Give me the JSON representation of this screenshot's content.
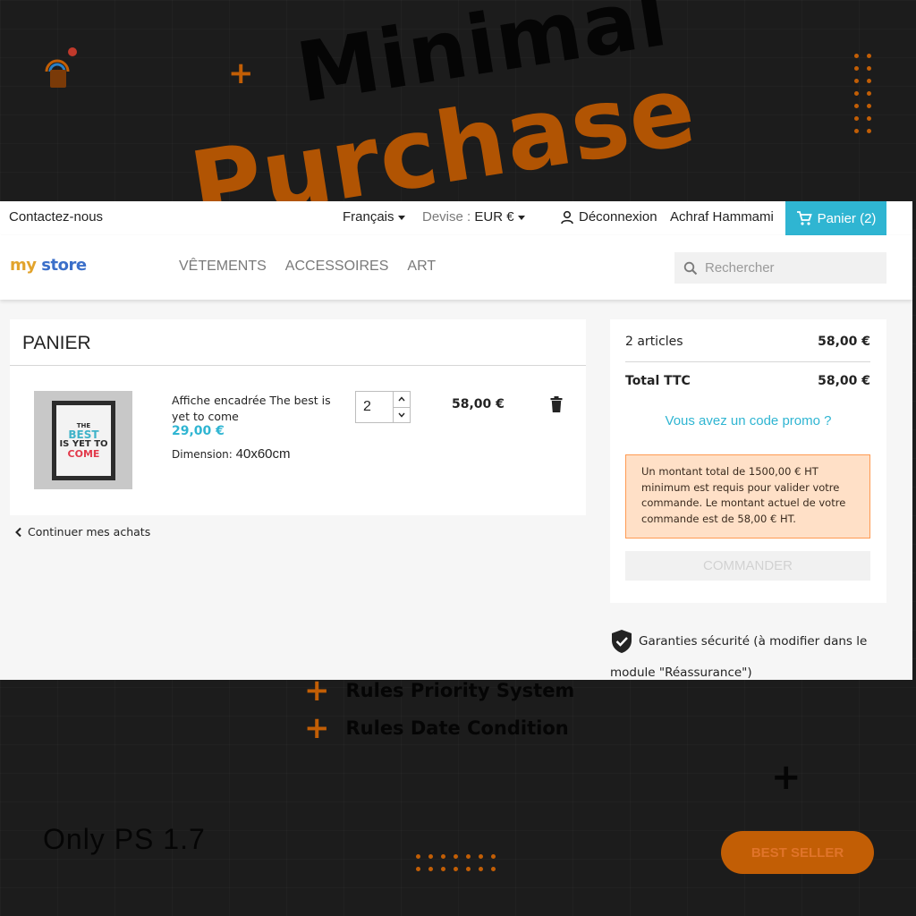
{
  "promo": {
    "title_line1": "Minimal",
    "title_line2": "Purchase",
    "features": [
      "Rules Priority System",
      "Rules Date Condition"
    ],
    "only_ps": "Only PS 1.7",
    "badge": "BEST SELLER",
    "accent_color": "#c25e05"
  },
  "topbar": {
    "contact": "Contactez-nous",
    "language": "Français",
    "currency_label": "Devise :",
    "currency_value": "EUR €",
    "logout": "Déconnexion",
    "username": "Achraf Hammami",
    "cart_label": "Panier (2)"
  },
  "header": {
    "logo_part1": "my",
    "logo_part2": "store",
    "nav": [
      "VÊTEMENTS",
      "ACCESSOIRES",
      "ART"
    ],
    "search_placeholder": "Rechercher"
  },
  "cart": {
    "title": "PANIER",
    "item": {
      "name": "Affiche encadrée The best is yet to come",
      "unit_price": "29,00 €",
      "attr_label": "Dimension:",
      "attr_value": "40x60cm",
      "quantity": "2",
      "total": "58,00 €",
      "image_text": [
        "THE",
        "BEST",
        "IS YET TO",
        "COME"
      ]
    },
    "continue_link": "Continuer mes achats"
  },
  "summary": {
    "items_label": "2 articles",
    "items_amount": "58,00 €",
    "total_label": "Total TTC",
    "total_amount": "58,00 €",
    "promo_link": "Vous avez un code promo ?",
    "alert": "Un montant total de 1500,00 € HT minimum est requis pour valider votre commande. Le montant actuel de votre commande est de 58,00 € HT.",
    "order_button": "COMMANDER"
  },
  "reassurance": "Garanties sécurité (à modifier dans le module \"Réassurance\")",
  "colors": {
    "brand": "#2fb5d2",
    "alert_bg": "#ffe0c7",
    "alert_border": "#ff9a52"
  }
}
